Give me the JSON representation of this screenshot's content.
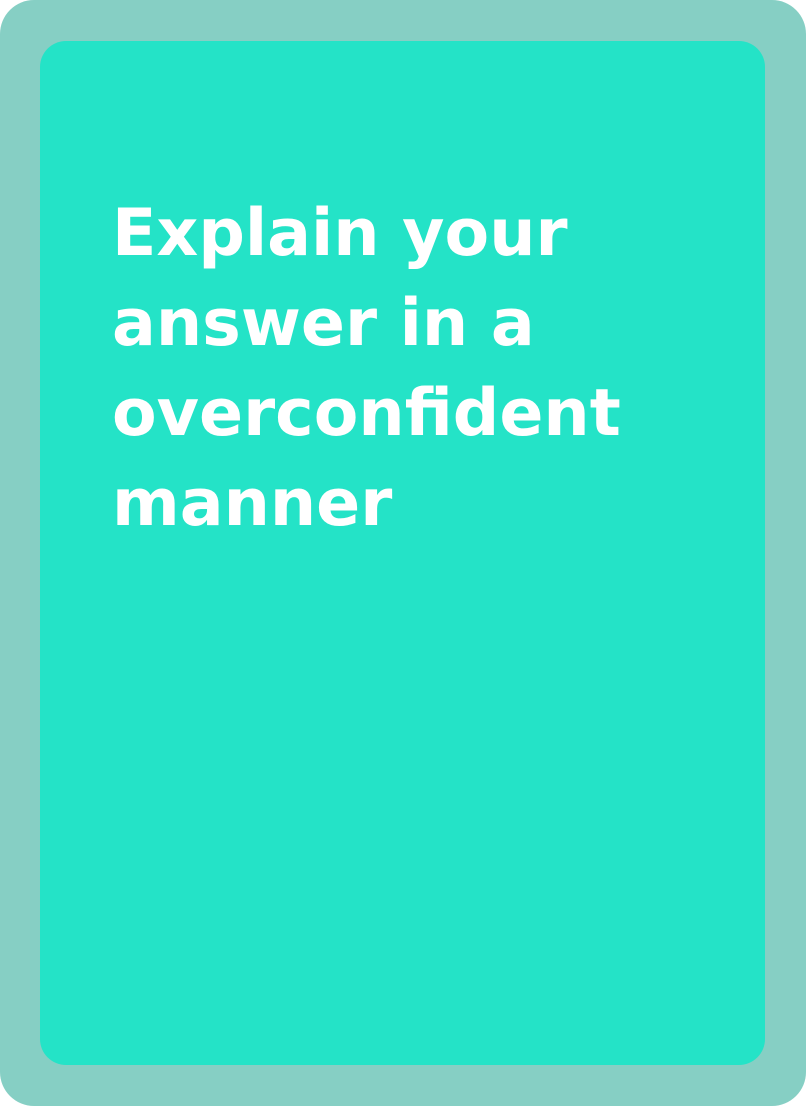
{
  "card": {
    "prompt_lines": [
      "Explain your",
      "answer in a",
      "overconfident",
      "manner"
    ]
  },
  "colors": {
    "outer_border": "#86cfc4",
    "inner_fill": "#24e3c7",
    "text": "#ffffff"
  }
}
